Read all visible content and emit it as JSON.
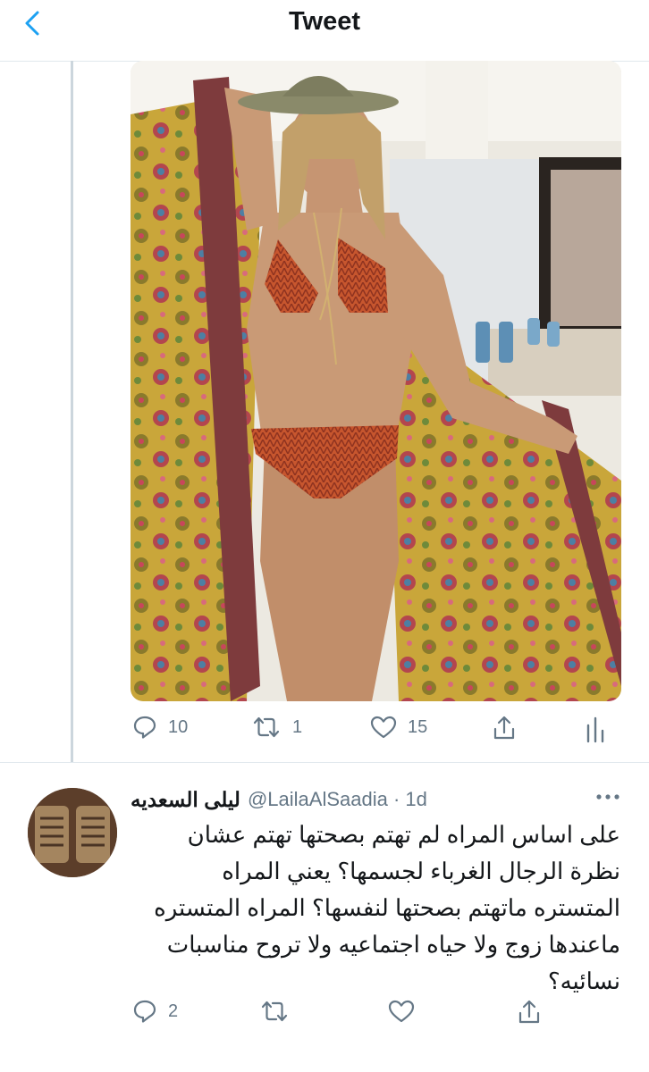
{
  "header": {
    "title": "Tweet"
  },
  "tweet": {
    "stats": {
      "replies": "10",
      "retweets": "1",
      "likes": "15"
    }
  },
  "reply": {
    "author_name": "ليلى السعديه",
    "handle_line": "@LailaAlSaadia · 1d",
    "text": "على اساس المراه لم تهتم بصحتها تهتم عشان نظرة الرجال الغرباء لجسمها؟ يعني المراه المتستره ماتهتم بصحتها لنفسها؟ المراه المتستره ماعندها زوج ولا حياه اجتماعيه ولا تروح مناسبات نسائيه؟",
    "stats": {
      "replies": "2"
    }
  },
  "colors": {
    "accent": "#1da1f2",
    "secondary": "#657786",
    "divider": "#e1e8ed"
  },
  "icons": [
    "chevron-left-icon",
    "reply-icon",
    "retweet-icon",
    "like-icon",
    "share-icon",
    "analytics-icon",
    "more-icon"
  ]
}
